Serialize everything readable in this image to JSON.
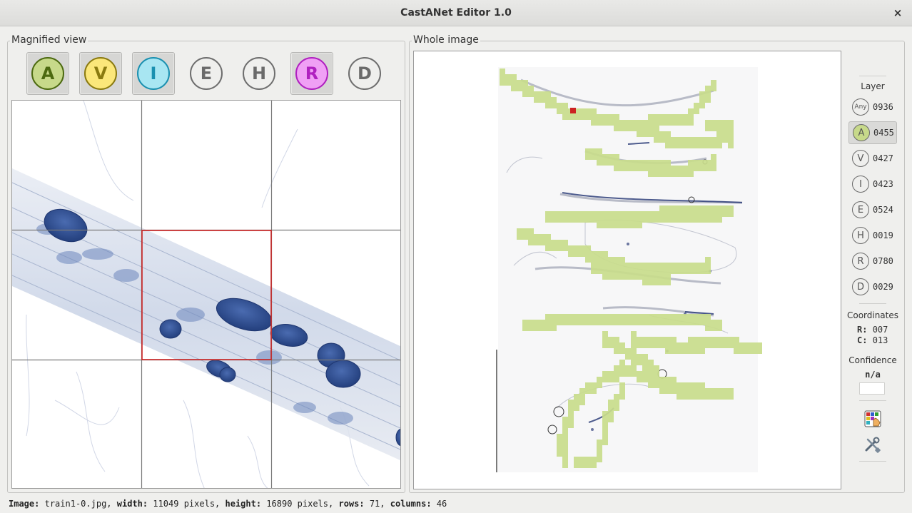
{
  "window": {
    "title": "CastANet Editor 1.0",
    "close_symbol": "×"
  },
  "magnified": {
    "label": "Magnified view",
    "buttons": [
      {
        "letter": "A",
        "active": true,
        "fill": "#c7d98a",
        "stroke": "#4c6a10",
        "text": "#4c6a10"
      },
      {
        "letter": "V",
        "active": true,
        "fill": "#fbe77a",
        "stroke": "#8a7a10",
        "text": "#8a7a10"
      },
      {
        "letter": "I",
        "active": true,
        "fill": "#a8e6f2",
        "stroke": "#1a90b0",
        "text": "#1a90b0"
      },
      {
        "letter": "E",
        "active": false,
        "fill": "none",
        "stroke": "#6e6e6e",
        "text": "#6a6a6a"
      },
      {
        "letter": "H",
        "active": false,
        "fill": "none",
        "stroke": "#6e6e6e",
        "text": "#6a6a6a"
      },
      {
        "letter": "R",
        "active": true,
        "fill": "#f0a0f5",
        "stroke": "#b020c0",
        "text": "#b020c0"
      },
      {
        "letter": "D",
        "active": false,
        "fill": "none",
        "stroke": "#6e6e6e",
        "text": "#6a6a6a"
      }
    ]
  },
  "whole": {
    "label": "Whole image"
  },
  "side": {
    "layer_title": "Layer",
    "layers": [
      {
        "code": "Any",
        "count": "0936",
        "active": false
      },
      {
        "code": "A",
        "count": "0455",
        "active": true
      },
      {
        "code": "V",
        "count": "0427",
        "active": false
      },
      {
        "code": "I",
        "count": "0423",
        "active": false
      },
      {
        "code": "E",
        "count": "0524",
        "active": false
      },
      {
        "code": "H",
        "count": "0019",
        "active": false
      },
      {
        "code": "R",
        "count": "0780",
        "active": false
      },
      {
        "code": "D",
        "count": "0029",
        "active": false
      }
    ],
    "coordinates_title": "Coordinates",
    "row_label": "R:",
    "row_value": "007",
    "col_label": "C:",
    "col_value": "013",
    "confidence_title": "Confidence",
    "confidence_value": "n/a",
    "icons": [
      "palette-icon",
      "settings-tools-icon"
    ]
  },
  "status": {
    "image_label": "Image:",
    "image_value": "train1-0.jpg,",
    "width_label": "width:",
    "width_value": "11049 pixels,",
    "height_label": "height:",
    "height_value": "16890 pixels,",
    "rows_label": "rows:",
    "rows_value": "71,",
    "columns_label": "columns:",
    "columns_value": "46"
  },
  "colors": {
    "annotation_green": "#c9dd8c",
    "selection_red": "#cc2222",
    "stain_blue": "#2f4f90"
  }
}
